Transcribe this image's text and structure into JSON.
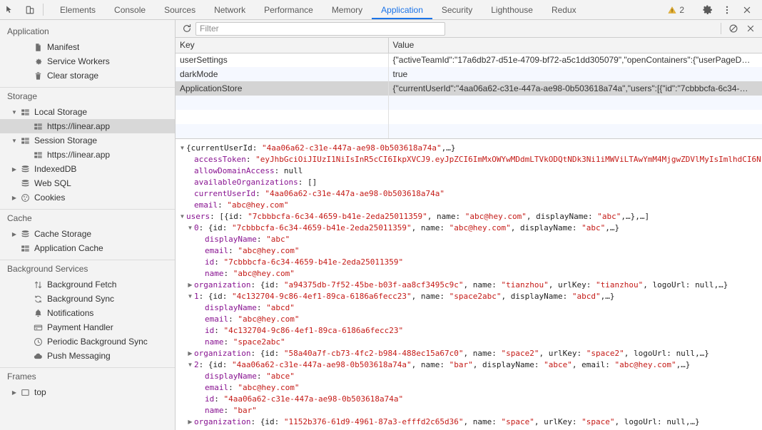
{
  "toolbar": {
    "icons": [
      {
        "name": "inspect-element-icon",
        "glyph": "inspect"
      },
      {
        "name": "device-toolbar-icon",
        "glyph": "device"
      }
    ],
    "tabs": [
      {
        "label": "Elements",
        "active": false
      },
      {
        "label": "Console",
        "active": false
      },
      {
        "label": "Sources",
        "active": false
      },
      {
        "label": "Network",
        "active": false
      },
      {
        "label": "Performance",
        "active": false
      },
      {
        "label": "Memory",
        "active": false
      },
      {
        "label": "Application",
        "active": true
      },
      {
        "label": "Security",
        "active": false
      },
      {
        "label": "Lighthouse",
        "active": false
      },
      {
        "label": "Redux",
        "active": false
      }
    ],
    "warning_count": "2",
    "settings_label": "gear-icon",
    "more_label": "more-options-icon",
    "close_label": "close-icon"
  },
  "sidebar": {
    "groups": [
      {
        "title": "Application",
        "items": [
          {
            "label": "Manifest",
            "icon": "manifest-icon",
            "indent": 2,
            "twisty": "none",
            "selected": false
          },
          {
            "label": "Service Workers",
            "icon": "gear-icon",
            "indent": 2,
            "twisty": "none",
            "selected": false
          },
          {
            "label": "Clear storage",
            "icon": "trash-icon",
            "indent": 2,
            "twisty": "none",
            "selected": false
          }
        ]
      },
      {
        "title": "Storage",
        "items": [
          {
            "label": "Local Storage",
            "icon": "storage-grid-icon",
            "indent": 1,
            "twisty": "open",
            "selected": false
          },
          {
            "label": "https://linear.app",
            "icon": "storage-grid-icon",
            "indent": 2,
            "twisty": "none",
            "selected": true
          },
          {
            "label": "Session Storage",
            "icon": "storage-grid-icon",
            "indent": 1,
            "twisty": "open",
            "selected": false
          },
          {
            "label": "https://linear.app",
            "icon": "storage-grid-icon",
            "indent": 2,
            "twisty": "none",
            "selected": false
          },
          {
            "label": "IndexedDB",
            "icon": "database-icon",
            "indent": 1,
            "twisty": "closed",
            "selected": false
          },
          {
            "label": "Web SQL",
            "icon": "database-icon",
            "indent": 1,
            "twisty": "none",
            "selected": false
          },
          {
            "label": "Cookies",
            "icon": "cookie-icon",
            "indent": 1,
            "twisty": "closed",
            "selected": false
          }
        ]
      },
      {
        "title": "Cache",
        "items": [
          {
            "label": "Cache Storage",
            "icon": "database-icon",
            "indent": 1,
            "twisty": "closed",
            "selected": false
          },
          {
            "label": "Application Cache",
            "icon": "storage-grid-icon",
            "indent": 1,
            "twisty": "none",
            "selected": false
          }
        ]
      },
      {
        "title": "Background Services",
        "items": [
          {
            "label": "Background Fetch",
            "icon": "arrows-updown-icon",
            "indent": 2,
            "twisty": "none",
            "selected": false
          },
          {
            "label": "Background Sync",
            "icon": "sync-icon",
            "indent": 2,
            "twisty": "none",
            "selected": false
          },
          {
            "label": "Notifications",
            "icon": "bell-icon",
            "indent": 2,
            "twisty": "none",
            "selected": false
          },
          {
            "label": "Payment Handler",
            "icon": "credit-card-icon",
            "indent": 2,
            "twisty": "none",
            "selected": false
          },
          {
            "label": "Periodic Background Sync",
            "icon": "clock-icon",
            "indent": 2,
            "twisty": "none",
            "selected": false
          },
          {
            "label": "Push Messaging",
            "icon": "cloud-icon",
            "indent": 2,
            "twisty": "none",
            "selected": false
          }
        ]
      },
      {
        "title": "Frames",
        "items": [
          {
            "label": "top",
            "icon": "frame-icon",
            "indent": 1,
            "twisty": "closed",
            "selected": false
          }
        ]
      }
    ]
  },
  "filterbar": {
    "refresh_icon": "refresh-icon",
    "filter_placeholder": "Filter",
    "filter_value": "",
    "clear_all_icon": "clear-all-icon",
    "delete_selected_icon": "delete-selected-icon"
  },
  "table": {
    "columns": [
      "Key",
      "Value"
    ],
    "rows": [
      {
        "key": "userSettings",
        "value": "{\"activeTeamId\":\"17a6db27-d51e-4709-bf72-a5c1dd305079\",\"openContainers\":{\"userPageD…",
        "selected": false
      },
      {
        "key": "darkMode",
        "value": "true",
        "selected": false
      },
      {
        "key": "ApplicationStore",
        "value": "{\"currentUserId\":\"4aa06a62-c31e-447a-ae98-0b503618a74a\",\"users\":[{\"id\":\"7cbbbcfa-6c34-…",
        "selected": true
      }
    ]
  },
  "preview": {
    "lines": [
      {
        "indent": 0,
        "twisty": "open",
        "parts": [
          {
            "t": "{currentUserId: ",
            "c": "plain"
          },
          {
            "t": "\"4aa06a62-c31e-447a-ae98-0b503618a74a\"",
            "c": "str"
          },
          {
            "t": ",…}",
            "c": "plain"
          }
        ]
      },
      {
        "indent": 1,
        "twisty": "none",
        "parts": [
          {
            "t": "accessToken",
            "c": "name"
          },
          {
            "t": ": ",
            "c": "plain"
          },
          {
            "t": "\"eyJhbGciOiJIUzI1NiIsInR5cCI6IkpXVCJ9.eyJpZCI6ImMxOWYwMDdmLTVkODQtNDk3Ni1iMWViLTAwYmM4MjgwZDVlMyIsImlhdCI6N",
            "c": "str"
          }
        ]
      },
      {
        "indent": 1,
        "twisty": "none",
        "parts": [
          {
            "t": "allowDomainAccess",
            "c": "name"
          },
          {
            "t": ": ",
            "c": "plain"
          },
          {
            "t": "null",
            "c": "null"
          }
        ]
      },
      {
        "indent": 1,
        "twisty": "none",
        "parts": [
          {
            "t": "availableOrganizations",
            "c": "name"
          },
          {
            "t": ": ",
            "c": "plain"
          },
          {
            "t": "[]",
            "c": "plain"
          }
        ]
      },
      {
        "indent": 1,
        "twisty": "none",
        "parts": [
          {
            "t": "currentUserId",
            "c": "name"
          },
          {
            "t": ": ",
            "c": "plain"
          },
          {
            "t": "\"4aa06a62-c31e-447a-ae98-0b503618a74a\"",
            "c": "str"
          }
        ]
      },
      {
        "indent": 1,
        "twisty": "none",
        "parts": [
          {
            "t": "email",
            "c": "name"
          },
          {
            "t": ": ",
            "c": "plain"
          },
          {
            "t": "\"abc@hey.com\"",
            "c": "str"
          }
        ]
      },
      {
        "indent": 0,
        "twisty": "open",
        "parts": [
          {
            "t": "users",
            "c": "name"
          },
          {
            "t": ": [{id: ",
            "c": "plain"
          },
          {
            "t": "\"7cbbbcfa-6c34-4659-b41e-2eda25011359\"",
            "c": "str"
          },
          {
            "t": ", name: ",
            "c": "plain"
          },
          {
            "t": "\"abc@hey.com\"",
            "c": "str"
          },
          {
            "t": ", displayName: ",
            "c": "plain"
          },
          {
            "t": "\"abc\"",
            "c": "str"
          },
          {
            "t": ",…},…]",
            "c": "plain"
          }
        ]
      },
      {
        "indent": 1,
        "twisty": "open",
        "parts": [
          {
            "t": "0",
            "c": "name"
          },
          {
            "t": ": {id: ",
            "c": "plain"
          },
          {
            "t": "\"7cbbbcfa-6c34-4659-b41e-2eda25011359\"",
            "c": "str"
          },
          {
            "t": ", name: ",
            "c": "plain"
          },
          {
            "t": "\"abc@hey.com\"",
            "c": "str"
          },
          {
            "t": ", displayName: ",
            "c": "plain"
          },
          {
            "t": "\"abc\"",
            "c": "str"
          },
          {
            "t": ",…}",
            "c": "plain"
          }
        ]
      },
      {
        "indent": 2,
        "twisty": "none",
        "parts": [
          {
            "t": "displayName",
            "c": "name"
          },
          {
            "t": ": ",
            "c": "plain"
          },
          {
            "t": "\"abc\"",
            "c": "str"
          }
        ]
      },
      {
        "indent": 2,
        "twisty": "none",
        "parts": [
          {
            "t": "email",
            "c": "name"
          },
          {
            "t": ": ",
            "c": "plain"
          },
          {
            "t": "\"abc@hey.com\"",
            "c": "str"
          }
        ]
      },
      {
        "indent": 2,
        "twisty": "none",
        "parts": [
          {
            "t": "id",
            "c": "name"
          },
          {
            "t": ": ",
            "c": "plain"
          },
          {
            "t": "\"7cbbbcfa-6c34-4659-b41e-2eda25011359\"",
            "c": "str"
          }
        ]
      },
      {
        "indent": 2,
        "twisty": "none",
        "parts": [
          {
            "t": "name",
            "c": "name"
          },
          {
            "t": ": ",
            "c": "plain"
          },
          {
            "t": "\"abc@hey.com\"",
            "c": "str"
          }
        ]
      },
      {
        "indent": 1,
        "twisty": "closed",
        "parts": [
          {
            "t": "organization",
            "c": "name"
          },
          {
            "t": ": {id: ",
            "c": "plain"
          },
          {
            "t": "\"a94375db-7f52-45be-b03f-aa8cf3495c9c\"",
            "c": "str"
          },
          {
            "t": ", name: ",
            "c": "plain"
          },
          {
            "t": "\"tianzhou\"",
            "c": "str"
          },
          {
            "t": ", urlKey: ",
            "c": "plain"
          },
          {
            "t": "\"tianzhou\"",
            "c": "str"
          },
          {
            "t": ", logoUrl: ",
            "c": "plain"
          },
          {
            "t": "null",
            "c": "null"
          },
          {
            "t": ",…}",
            "c": "plain"
          }
        ]
      },
      {
        "indent": 1,
        "twisty": "open",
        "parts": [
          {
            "t": "1",
            "c": "name"
          },
          {
            "t": ": {id: ",
            "c": "plain"
          },
          {
            "t": "\"4c132704-9c86-4ef1-89ca-6186a6fecc23\"",
            "c": "str"
          },
          {
            "t": ", name: ",
            "c": "plain"
          },
          {
            "t": "\"space2abc\"",
            "c": "str"
          },
          {
            "t": ", displayName: ",
            "c": "plain"
          },
          {
            "t": "\"abcd\"",
            "c": "str"
          },
          {
            "t": ",…}",
            "c": "plain"
          }
        ]
      },
      {
        "indent": 2,
        "twisty": "none",
        "parts": [
          {
            "t": "displayName",
            "c": "name"
          },
          {
            "t": ": ",
            "c": "plain"
          },
          {
            "t": "\"abcd\"",
            "c": "str"
          }
        ]
      },
      {
        "indent": 2,
        "twisty": "none",
        "parts": [
          {
            "t": "email",
            "c": "name"
          },
          {
            "t": ": ",
            "c": "plain"
          },
          {
            "t": "\"abc@hey.com\"",
            "c": "str"
          }
        ]
      },
      {
        "indent": 2,
        "twisty": "none",
        "parts": [
          {
            "t": "id",
            "c": "name"
          },
          {
            "t": ": ",
            "c": "plain"
          },
          {
            "t": "\"4c132704-9c86-4ef1-89ca-6186a6fecc23\"",
            "c": "str"
          }
        ]
      },
      {
        "indent": 2,
        "twisty": "none",
        "parts": [
          {
            "t": "name",
            "c": "name"
          },
          {
            "t": ": ",
            "c": "plain"
          },
          {
            "t": "\"space2abc\"",
            "c": "str"
          }
        ]
      },
      {
        "indent": 1,
        "twisty": "closed",
        "parts": [
          {
            "t": "organization",
            "c": "name"
          },
          {
            "t": ": {id: ",
            "c": "plain"
          },
          {
            "t": "\"58a40a7f-cb73-4fc2-b984-488ec15a67c0\"",
            "c": "str"
          },
          {
            "t": ", name: ",
            "c": "plain"
          },
          {
            "t": "\"space2\"",
            "c": "str"
          },
          {
            "t": ", urlKey: ",
            "c": "plain"
          },
          {
            "t": "\"space2\"",
            "c": "str"
          },
          {
            "t": ", logoUrl: ",
            "c": "plain"
          },
          {
            "t": "null",
            "c": "null"
          },
          {
            "t": ",…}",
            "c": "plain"
          }
        ]
      },
      {
        "indent": 1,
        "twisty": "open",
        "parts": [
          {
            "t": "2",
            "c": "name"
          },
          {
            "t": ": {id: ",
            "c": "plain"
          },
          {
            "t": "\"4aa06a62-c31e-447a-ae98-0b503618a74a\"",
            "c": "str"
          },
          {
            "t": ", name: ",
            "c": "plain"
          },
          {
            "t": "\"bar\"",
            "c": "str"
          },
          {
            "t": ", displayName: ",
            "c": "plain"
          },
          {
            "t": "\"abce\"",
            "c": "str"
          },
          {
            "t": ", email: ",
            "c": "plain"
          },
          {
            "t": "\"abc@hey.com\"",
            "c": "str"
          },
          {
            "t": ",…}",
            "c": "plain"
          }
        ]
      },
      {
        "indent": 2,
        "twisty": "none",
        "parts": [
          {
            "t": "displayName",
            "c": "name"
          },
          {
            "t": ": ",
            "c": "plain"
          },
          {
            "t": "\"abce\"",
            "c": "str"
          }
        ]
      },
      {
        "indent": 2,
        "twisty": "none",
        "parts": [
          {
            "t": "email",
            "c": "name"
          },
          {
            "t": ": ",
            "c": "plain"
          },
          {
            "t": "\"abc@hey.com\"",
            "c": "str"
          }
        ]
      },
      {
        "indent": 2,
        "twisty": "none",
        "parts": [
          {
            "t": "id",
            "c": "name"
          },
          {
            "t": ": ",
            "c": "plain"
          },
          {
            "t": "\"4aa06a62-c31e-447a-ae98-0b503618a74a\"",
            "c": "str"
          }
        ]
      },
      {
        "indent": 2,
        "twisty": "none",
        "parts": [
          {
            "t": "name",
            "c": "name"
          },
          {
            "t": ": ",
            "c": "plain"
          },
          {
            "t": "\"bar\"",
            "c": "str"
          }
        ]
      },
      {
        "indent": 1,
        "twisty": "closed",
        "parts": [
          {
            "t": "organization",
            "c": "name"
          },
          {
            "t": ": {id: ",
            "c": "plain"
          },
          {
            "t": "\"1152b376-61d9-4961-87a3-efffd2c65d36\"",
            "c": "str"
          },
          {
            "t": ", name: ",
            "c": "plain"
          },
          {
            "t": "\"space\"",
            "c": "str"
          },
          {
            "t": ", urlKey: ",
            "c": "plain"
          },
          {
            "t": "\"space\"",
            "c": "str"
          },
          {
            "t": ", logoUrl: ",
            "c": "plain"
          },
          {
            "t": "null",
            "c": "null"
          },
          {
            "t": ",…}",
            "c": "plain"
          }
        ]
      }
    ]
  },
  "colors": {
    "accent": "#1a73e8",
    "warning": "#e8b339",
    "toolbar_bg": "#f3f3f3",
    "selected_row": "#d4d4d4",
    "json_key": "#881391",
    "json_string": "#c41a16"
  }
}
